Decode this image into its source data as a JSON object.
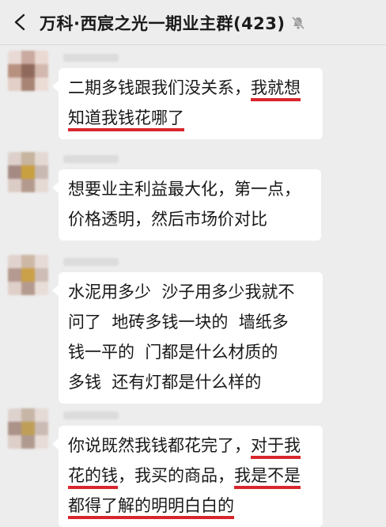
{
  "header": {
    "title": "万科·西宸之光一期业主群(423)",
    "back_icon": "chevron-left-icon",
    "mute_icon": "bell-muted-icon"
  },
  "messages": [
    {
      "lines": [
        [
          {
            "t": "二期多钱跟我们没关系，",
            "u": false
          },
          {
            "t": "我就想",
            "u": true
          }
        ],
        [
          {
            "t": "知道我钱花哪了",
            "u": true
          }
        ]
      ]
    },
    {
      "lines": [
        [
          {
            "t": "想要业主利益最大化，第一点，",
            "u": false
          }
        ],
        [
          {
            "t": "价格透明，然后市场价对比",
            "u": false
          }
        ]
      ]
    },
    {
      "lines": [
        [
          {
            "t": "水泥用多少  沙子用多少我就不",
            "u": false
          }
        ],
        [
          {
            "t": "问了  地砖多钱一块的  墙纸多",
            "u": false
          }
        ],
        [
          {
            "t": "钱一平的  门都是什么材质的",
            "u": false
          }
        ],
        [
          {
            "t": "多钱  还有灯都是什么样的",
            "u": false
          }
        ]
      ]
    },
    {
      "lines": [
        [
          {
            "t": "你说既然我钱都花完了，",
            "u": false
          },
          {
            "t": "对于我",
            "u": true
          }
        ],
        [
          {
            "t": "花的钱",
            "u": true
          },
          {
            "t": "，我买的商品，",
            "u": false
          },
          {
            "t": "我是不是",
            "u": true
          }
        ],
        [
          {
            "t": "都得了解的明明白白的",
            "u": true
          }
        ]
      ]
    }
  ],
  "colors": {
    "background": "#ededed",
    "bubble": "#ffffff",
    "underline": "#d8262c"
  }
}
